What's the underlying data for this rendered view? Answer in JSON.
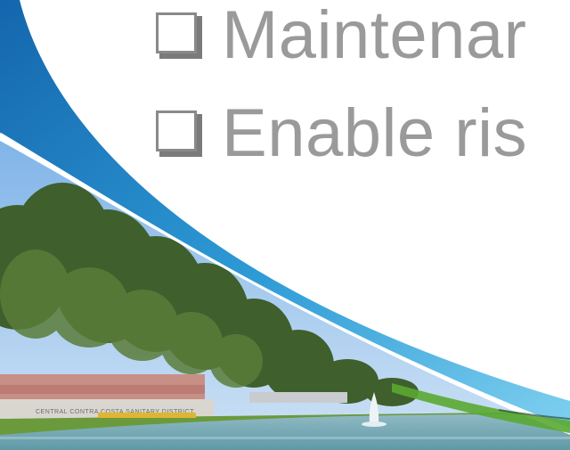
{
  "slide": {
    "bullets": [
      {
        "icon": "checkbox-icon",
        "text": "Maintenar"
      },
      {
        "icon": "checkbox-icon",
        "text": "Enable ris"
      }
    ],
    "photo": {
      "sign_text": "CENTRAL CONTRA COSTA SANITARY DISTRICT"
    }
  },
  "colors": {
    "swoosh_blue": "#1a7fc0",
    "swoosh_light": "#5ab8e0",
    "swoosh_green": "#5aa832",
    "bullet_text": "#9a9a9a"
  }
}
